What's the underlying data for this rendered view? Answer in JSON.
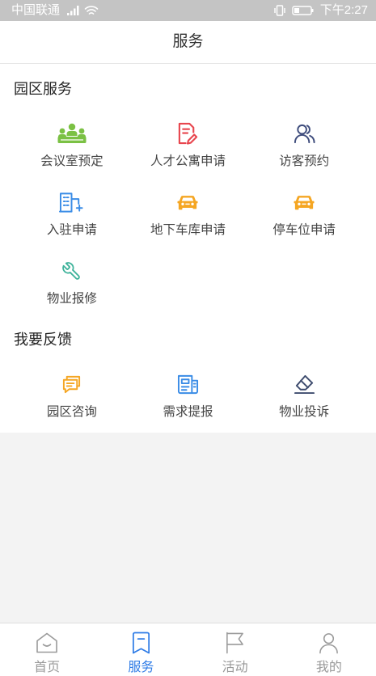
{
  "status_bar": {
    "carrier": "中国联通",
    "time": "下午2:27",
    "icons": [
      "signal-icon",
      "wifi-icon",
      "vibrate-icon",
      "battery-icon"
    ]
  },
  "header": {
    "title": "服务"
  },
  "sections": [
    {
      "title": "园区服务",
      "items": [
        {
          "label": "会议室预定",
          "icon": "meeting-room-icon",
          "color": "#7bc144"
        },
        {
          "label": "人才公寓申请",
          "icon": "apartment-application-icon",
          "color": "#e8464e"
        },
        {
          "label": "访客预约",
          "icon": "visitor-icon",
          "color": "#3e4c7c"
        },
        {
          "label": "入驻申请",
          "icon": "building-icon",
          "color": "#3a8ce6"
        },
        {
          "label": "地下车库申请",
          "icon": "car-icon",
          "color": "#f5a623"
        },
        {
          "label": "停车位申请",
          "icon": "car-icon",
          "color": "#f5a623"
        },
        {
          "label": "物业报修",
          "icon": "wrench-icon",
          "color": "#3fb39b"
        }
      ]
    },
    {
      "title": "我要反馈",
      "items": [
        {
          "label": "园区咨询",
          "icon": "chat-icon",
          "color": "#f5a623"
        },
        {
          "label": "需求提报",
          "icon": "newspaper-icon",
          "color": "#3a8ce6"
        },
        {
          "label": "物业投诉",
          "icon": "eraser-icon",
          "color": "#3e4c6e"
        }
      ]
    }
  ],
  "tab_bar": {
    "active_color": "#2f7ce6",
    "inactive_color": "#9a9a9a",
    "tabs": [
      {
        "label": "首页",
        "icon": "home-icon",
        "active": false
      },
      {
        "label": "服务",
        "icon": "bookmark-icon",
        "active": true
      },
      {
        "label": "活动",
        "icon": "flag-icon",
        "active": false
      },
      {
        "label": "我的",
        "icon": "person-icon",
        "active": false
      }
    ]
  }
}
